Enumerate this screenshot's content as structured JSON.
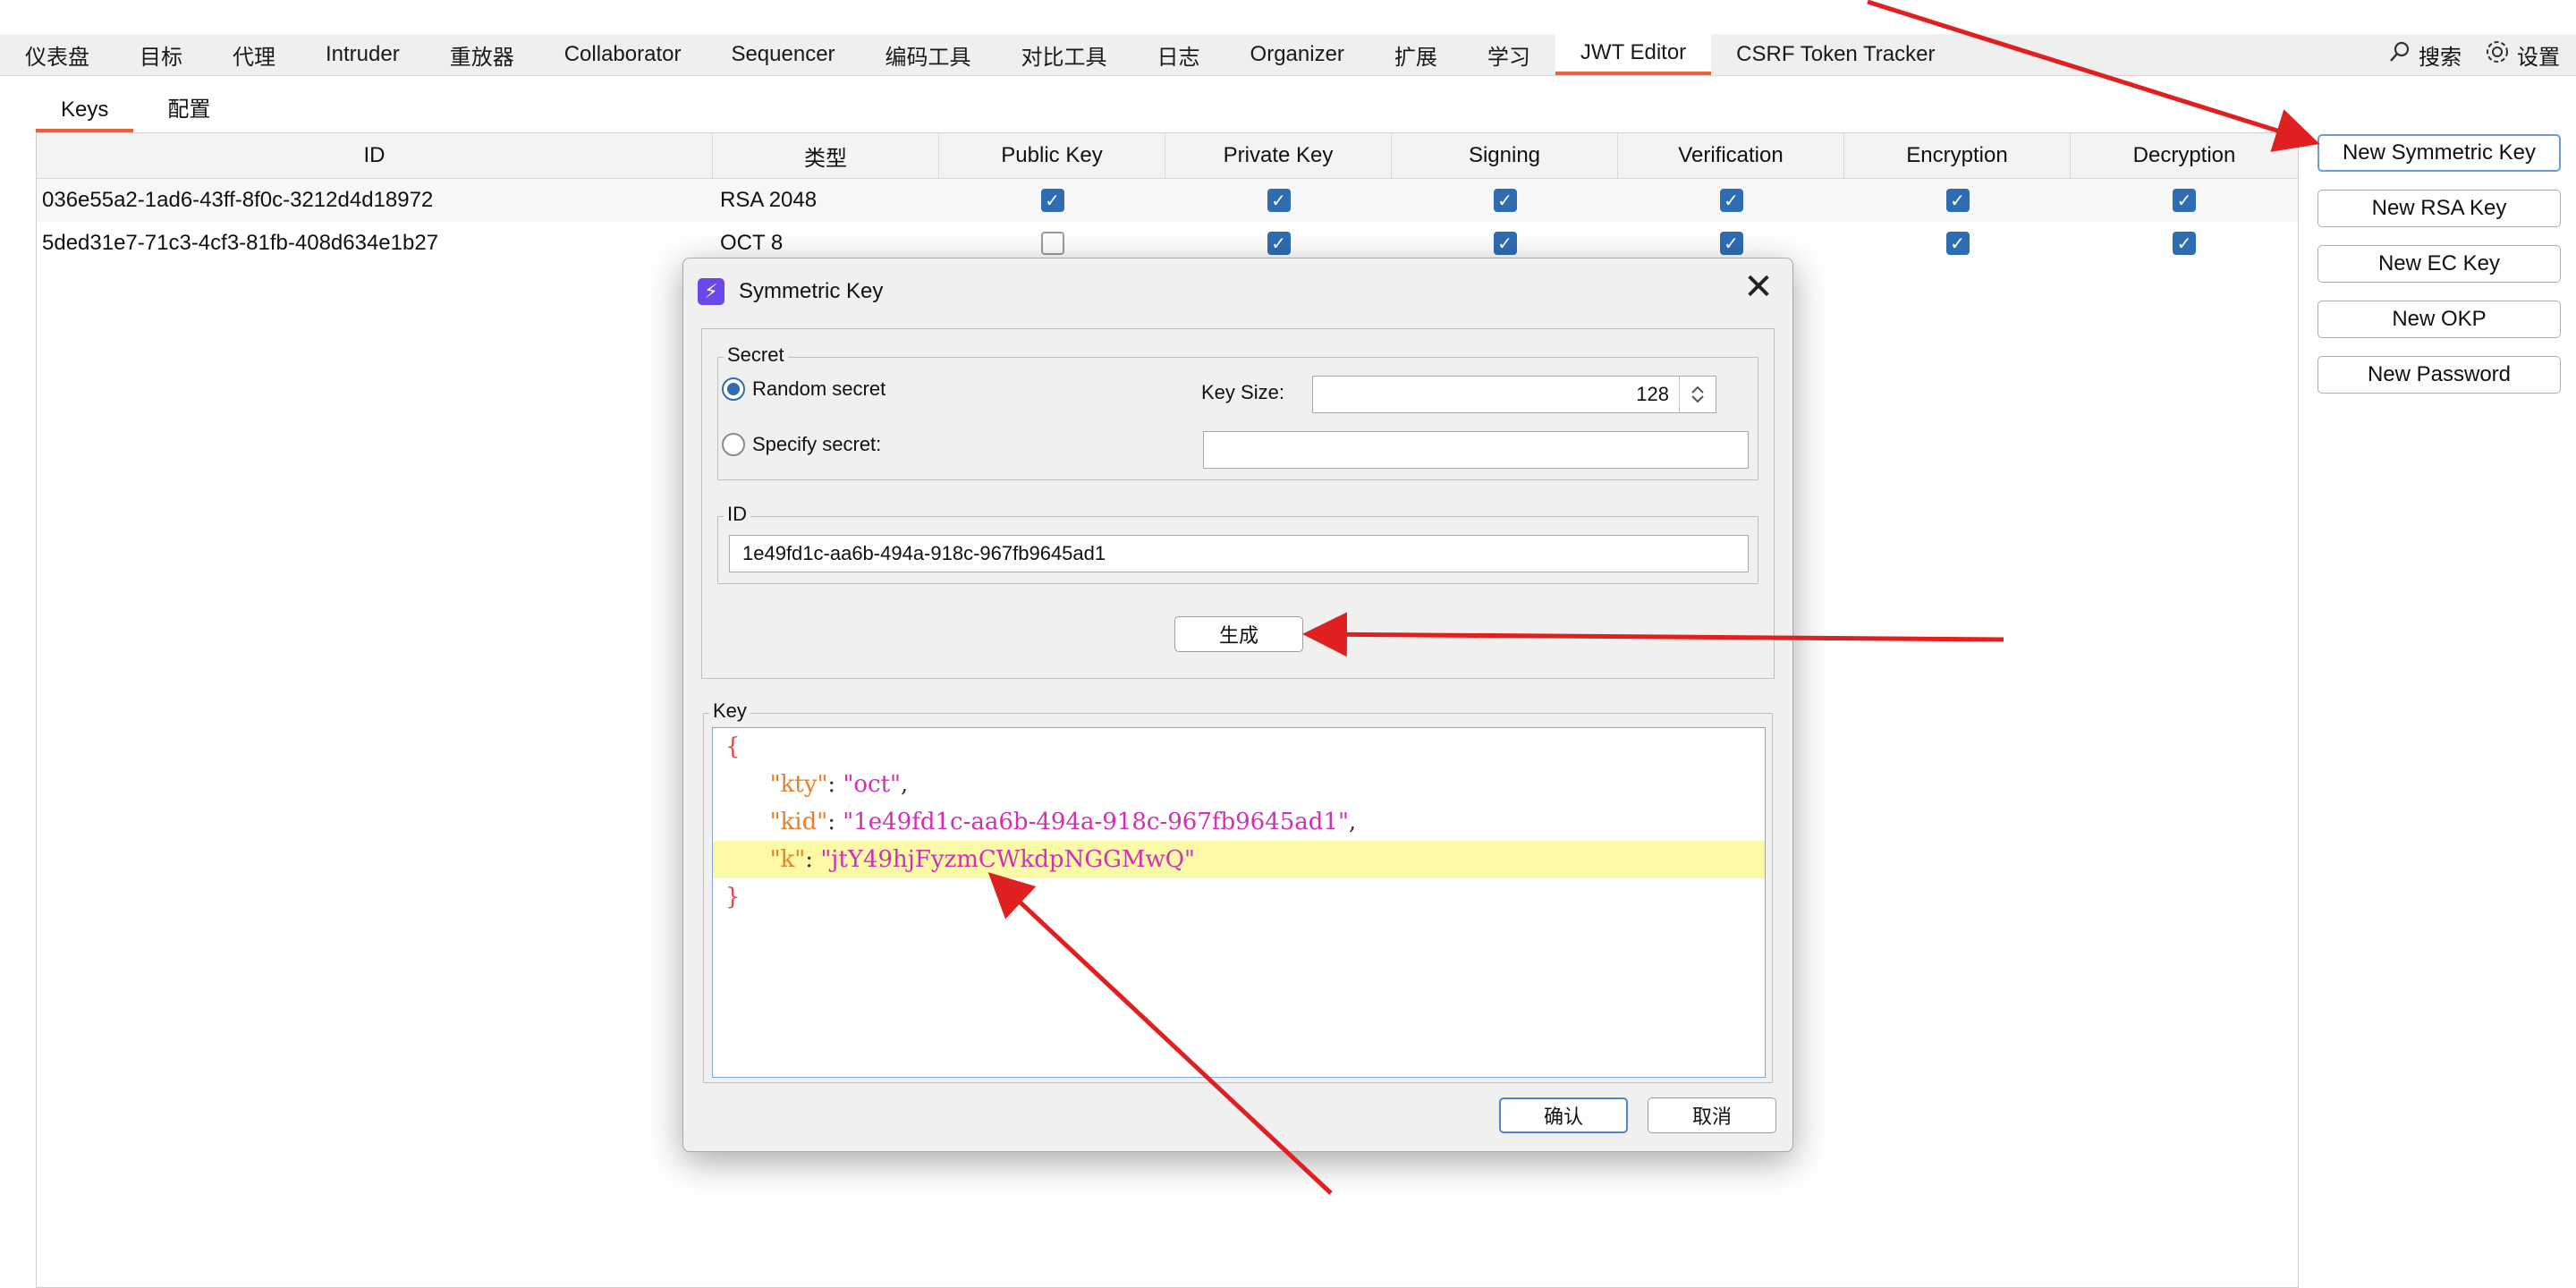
{
  "menu_tabs": [
    {
      "label": "仪表盘"
    },
    {
      "label": "目标"
    },
    {
      "label": "代理"
    },
    {
      "label": "Intruder"
    },
    {
      "label": "重放器"
    },
    {
      "label": "Collaborator"
    },
    {
      "label": "Sequencer"
    },
    {
      "label": "编码工具"
    },
    {
      "label": "对比工具"
    },
    {
      "label": "日志"
    },
    {
      "label": "Organizer"
    },
    {
      "label": "扩展"
    },
    {
      "label": "学习"
    },
    {
      "label": "JWT Editor",
      "active": true
    },
    {
      "label": "CSRF Token Tracker"
    }
  ],
  "top_actions": {
    "search_label": "搜索",
    "settings_label": "设置"
  },
  "sub_tabs": [
    {
      "label": "Keys",
      "active": true
    },
    {
      "label": "配置"
    }
  ],
  "table": {
    "columns": [
      "ID",
      "类型",
      "Public Key",
      "Private Key",
      "Signing",
      "Verification",
      "Encryption",
      "Decryption"
    ],
    "rows": [
      {
        "id": "036e55a2-1ad6-43ff-8f0c-3212d4d18972",
        "type": "RSA 2048",
        "flags": [
          true,
          true,
          true,
          true,
          true,
          true
        ]
      },
      {
        "id": "5ded31e7-71c3-4cf3-81fb-408d634e1b27",
        "type": "OCT 8",
        "flags": [
          false,
          true,
          true,
          true,
          true,
          true
        ]
      }
    ]
  },
  "side_buttons": [
    {
      "label": "New Symmetric Key"
    },
    {
      "label": "New RSA Key"
    },
    {
      "label": "New EC Key"
    },
    {
      "label": "New OKP"
    },
    {
      "label": "New Password"
    }
  ],
  "dialog": {
    "title": "Symmetric Key",
    "secret_legend": "Secret",
    "random_secret_label": "Random secret",
    "specify_secret_label": "Specify secret:",
    "key_size_label": "Key Size:",
    "key_size_value": "128",
    "specify_secret_value": "",
    "id_legend": "ID",
    "id_value": "1e49fd1c-aa6b-494a-918c-967fb9645ad1",
    "generate_label": "生成",
    "key_legend": "Key",
    "key_json": {
      "open": "{",
      "kty_key": "\"kty\"",
      "kty_val": "\"oct\"",
      "kid_key": "\"kid\"",
      "kid_val": "\"1e49fd1c-aa6b-494a-918c-967fb9645ad1\"",
      "k_key": "\"k\"",
      "k_val": "\"jtY49hjFyzmCWkdpNGGMwQ\"",
      "close": "}"
    },
    "ok_label": "确认",
    "cancel_label": "取消"
  },
  "colors": {
    "accent": "#e8633a",
    "checkbox": "#2f6db3",
    "annotation_arrow": "#e02020",
    "dialog_icon": "#6a48ea"
  },
  "icons": [
    "search-icon",
    "gear-icon",
    "lightning-icon",
    "close-icon",
    "spinner-arrows-icon",
    "check-icon"
  ]
}
